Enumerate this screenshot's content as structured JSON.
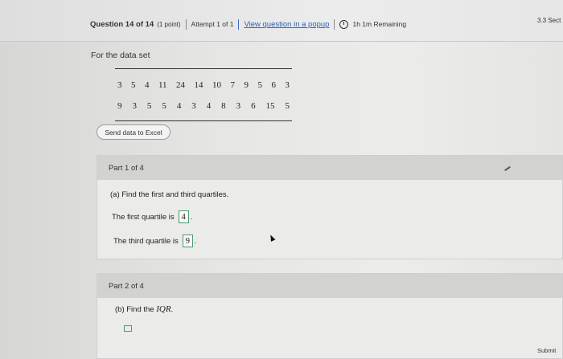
{
  "header": {
    "question_title": "Question 14 of 14",
    "points": "(1 point)",
    "attempt": "Attempt 1 of 1",
    "popup_link": "View question in a popup",
    "timer": "1h 1m Remaining",
    "score": "3.3 Sect"
  },
  "content": {
    "intro": "For the data set",
    "data_rows": [
      [
        "3",
        "5",
        "4",
        "11",
        "24",
        "14",
        "10",
        "7",
        "9",
        "5",
        "6",
        "3"
      ],
      [
        "9",
        "3",
        "5",
        "5",
        "4",
        "3",
        "4",
        "8",
        "3",
        "6",
        "15",
        "5"
      ]
    ],
    "excel_button": "Send data to Excel"
  },
  "part1": {
    "header": "Part 1 of 4",
    "question": "(a) Find the first and third quartiles.",
    "first_quartile_label": "The first quartile is",
    "first_quartile_value": "4",
    "third_quartile_label": "The third quartile is",
    "third_quartile_value": "9",
    "period": "."
  },
  "part2": {
    "header": "Part 2 of 4",
    "question_prefix": "(b) Find the",
    "question_var": "IQR",
    "question_suffix": "."
  },
  "footer": {
    "submit": "Submit"
  }
}
